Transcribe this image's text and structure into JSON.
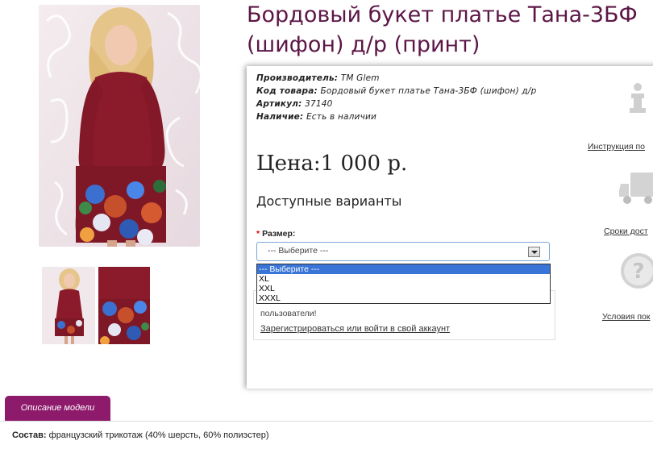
{
  "product": {
    "title": "Бордовый букет платье Тана-3БФ (шифон) д/р (принт)",
    "manufacturer_label": "Производитель:",
    "manufacturer_value": "TM Glem",
    "code_label": "Код товара:",
    "code_value": "Бордовый букет платье Тана-3БФ (шифон) д/р",
    "article_label": "Артикул:",
    "article_value": "37140",
    "availability_label": "Наличие:",
    "availability_value": "Есть в наличии",
    "price": "Цена:1 000 р.",
    "variants_heading": "Доступные варианты"
  },
  "size": {
    "label": "Размер:",
    "selected": "--- Выберите ---",
    "options": [
      "--- Выберите ---",
      "XL",
      "XXL",
      "XXXL"
    ]
  },
  "login_notice": {
    "text": "пользователи!",
    "link": "Зарегистрироваться или войти в свой аккаунт"
  },
  "sidebar": {
    "instructions_link": "Инструкция по",
    "delivery_link": "Сроки дост",
    "terms_link": "Условия пок"
  },
  "tabs": {
    "description": "Описание модели"
  },
  "composition": {
    "label": "Состав:",
    "value": "французский трикотаж (40% шерсть, 60% полиэстер)"
  },
  "colors": {
    "title": "#5c1646",
    "tab": "#8e1a6c",
    "dress": "#8b1a2b",
    "selection": "#3875d7"
  }
}
